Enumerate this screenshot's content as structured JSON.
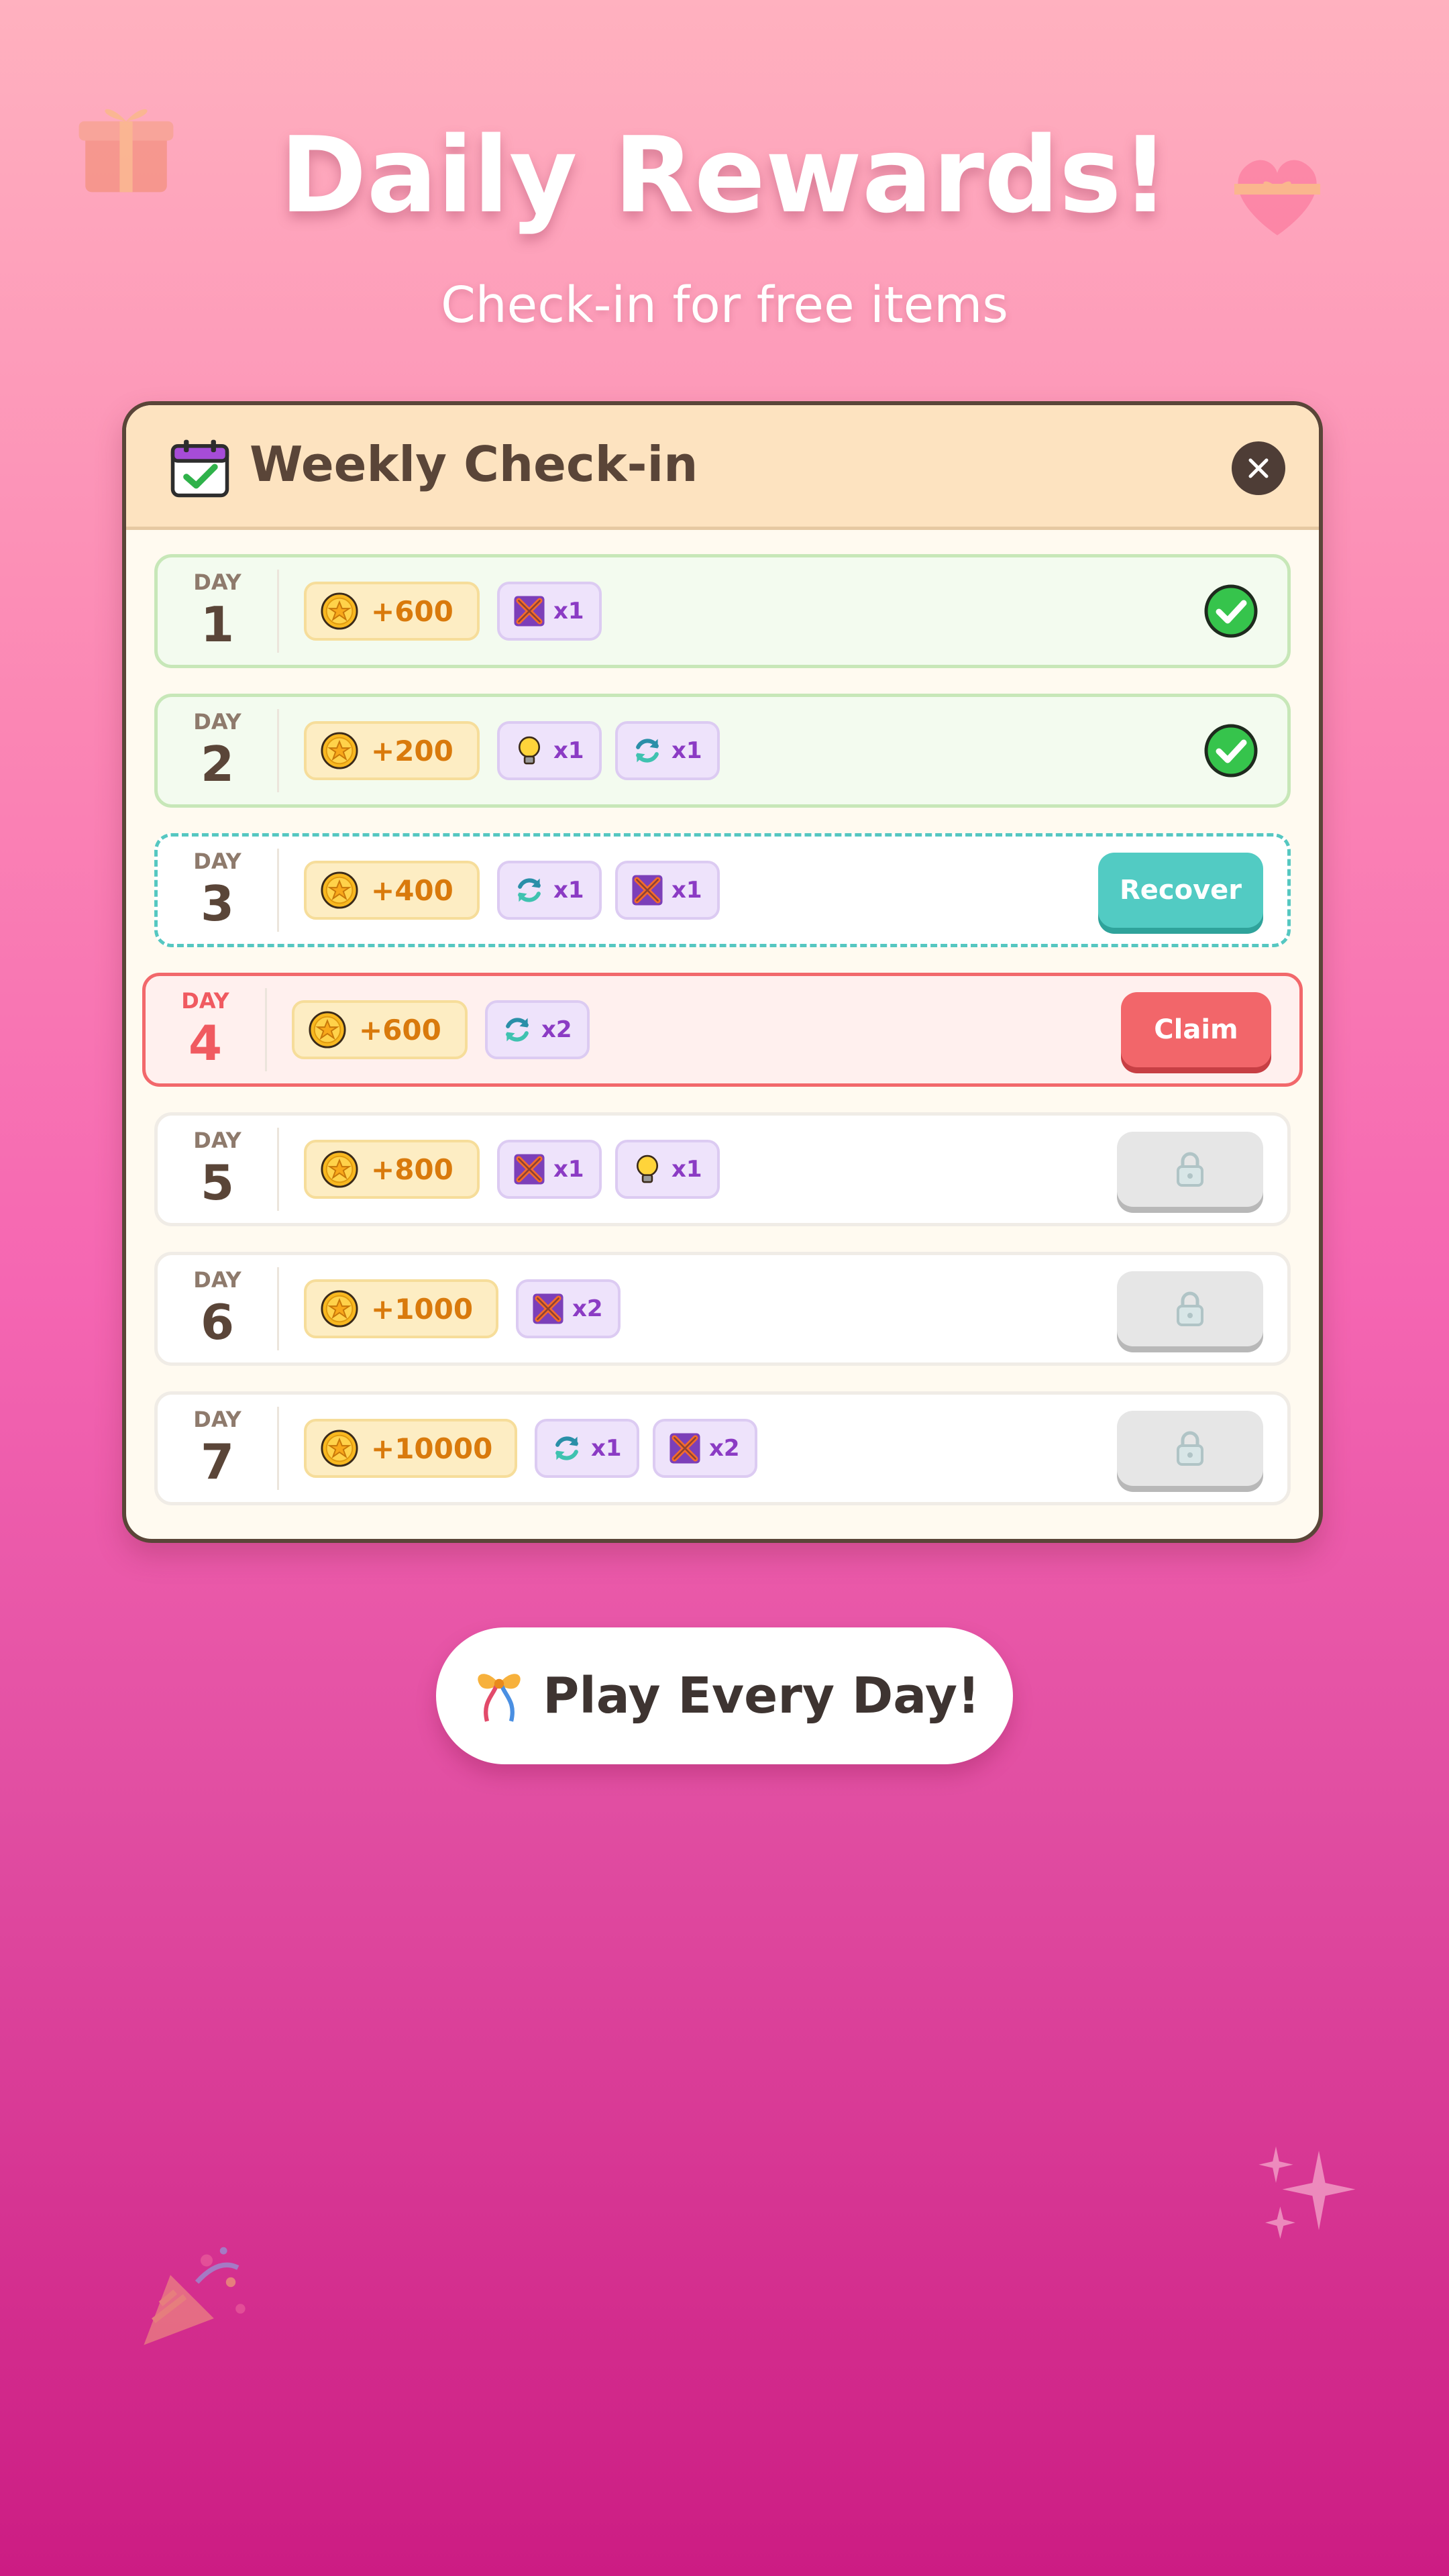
{
  "header": {
    "title": "Daily Rewards!",
    "subtitle": "Check-in for free items"
  },
  "card": {
    "title": "Weekly Check-in",
    "calendar_icon": "calendar-check-icon",
    "close_icon": "close-icon"
  },
  "days": [
    {
      "label": "DAY",
      "number": "1",
      "status": "claimed",
      "coins": "+600",
      "items": [
        {
          "icon": "shuffle-icon",
          "qty": "x1"
        }
      ]
    },
    {
      "label": "DAY",
      "number": "2",
      "status": "claimed",
      "coins": "+200",
      "items": [
        {
          "icon": "hint-bulb-icon",
          "qty": "x1"
        },
        {
          "icon": "refresh-icon",
          "qty": "x1"
        }
      ]
    },
    {
      "label": "DAY",
      "number": "3",
      "status": "missed",
      "coins": "+400",
      "items": [
        {
          "icon": "refresh-icon",
          "qty": "x1"
        },
        {
          "icon": "shuffle-icon",
          "qty": "x1"
        }
      ],
      "action": "Recover"
    },
    {
      "label": "DAY",
      "number": "4",
      "status": "today",
      "coins": "+600",
      "items": [
        {
          "icon": "refresh-icon",
          "qty": "x2"
        }
      ],
      "action": "Claim"
    },
    {
      "label": "DAY",
      "number": "5",
      "status": "locked",
      "coins": "+800",
      "items": [
        {
          "icon": "shuffle-icon",
          "qty": "x1"
        },
        {
          "icon": "hint-bulb-icon",
          "qty": "x1"
        }
      ]
    },
    {
      "label": "DAY",
      "number": "6",
      "status": "locked",
      "coins": "+1000",
      "items": [
        {
          "icon": "shuffle-icon",
          "qty": "x2"
        }
      ]
    },
    {
      "label": "DAY",
      "number": "7",
      "status": "locked",
      "coins": "+10000",
      "items": [
        {
          "icon": "refresh-icon",
          "qty": "x1"
        },
        {
          "icon": "shuffle-icon",
          "qty": "x2"
        }
      ]
    }
  ],
  "footer": {
    "play_label": "Play Every Day!",
    "play_icon": "ribbon-icon"
  },
  "colors": {
    "background_top": "#ffb1bf",
    "background_bottom": "#cc1c83",
    "claimed_border": "#c7e7b8",
    "missed_border": "#55c7c1",
    "today_border": "#f2686b",
    "recover_button": "#52cbc3",
    "claim_button": "#f2666a",
    "coin_text": "#d97a0c",
    "item_text": "#8b3bc4"
  }
}
